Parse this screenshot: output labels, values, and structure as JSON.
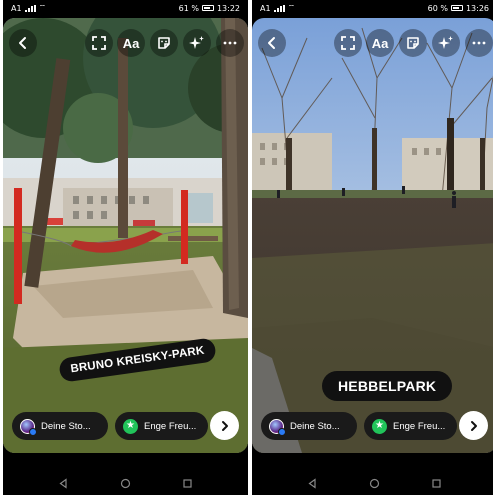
{
  "screens": [
    {
      "id": "left",
      "status": {
        "carrier": "A1",
        "battery": "61 %",
        "time": "13:22"
      },
      "location_sticker": "BRUNO KREISKY-PARK",
      "share": {
        "your_story": "Deine Sto...",
        "close_friends": "Enge Freu..."
      }
    },
    {
      "id": "right",
      "status": {
        "carrier": "A1",
        "battery": "60 %",
        "time": "13:26"
      },
      "location_sticker": "HEBBELPARK",
      "share": {
        "your_story": "Deine Sto...",
        "close_friends": "Enge Freu..."
      }
    }
  ],
  "toolbar": {
    "back_icon": "chevron-left-icon",
    "expand_icon": "expand-icon",
    "text_label": "Aa",
    "sticker_icon": "sticker-icon",
    "effects_icon": "sparkles-icon",
    "more_icon": "more-icon"
  },
  "colors": {
    "sticker_bg": "#111111",
    "close_friends_green": "#21c45a",
    "share_bg": "#1a1a1a"
  }
}
